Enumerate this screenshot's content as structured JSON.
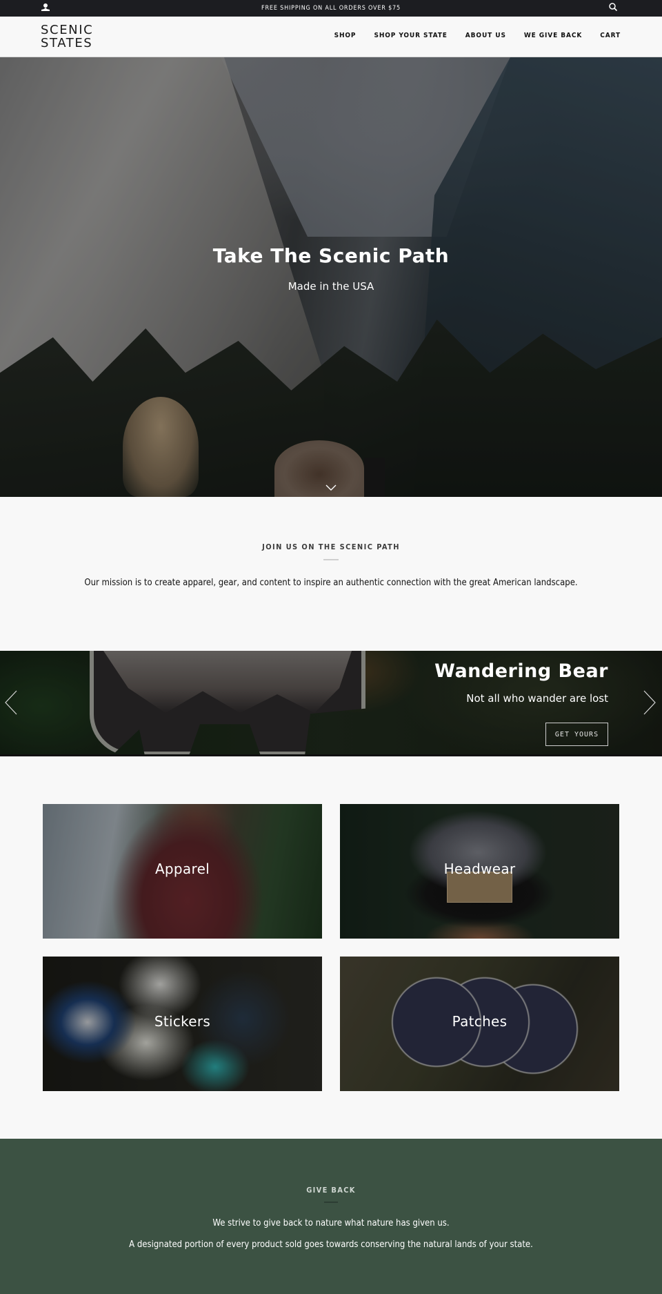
{
  "announcement": {
    "text": "FREE SHIPPING ON ALL ORDERS OVER $75",
    "left_icon": "user-icon",
    "right_icon": "search-icon"
  },
  "header": {
    "logo_line1": "SCENIC",
    "logo_line2": "STATES",
    "nav": [
      {
        "label": "SHOP"
      },
      {
        "label": "SHOP YOUR STATE"
      },
      {
        "label": "ABOUT US"
      },
      {
        "label": "WE GIVE BACK"
      },
      {
        "label": "CART"
      }
    ]
  },
  "hero": {
    "title": "Take The Scenic Path",
    "subtitle": "Made in the USA",
    "scroll_icon": "chevron-down-icon"
  },
  "mission": {
    "heading": "JOIN US ON THE SCENIC PATH",
    "text": "Our mission is to create apparel, gear, and content to inspire an authentic connection with the great American landscape."
  },
  "slideshow": {
    "title": "Wandering Bear",
    "subtitle": "Not all who wander are lost",
    "button_label": "GET YOURS",
    "prev_icon": "chevron-left-icon",
    "next_icon": "chevron-right-icon"
  },
  "collections": [
    {
      "label": "Apparel"
    },
    {
      "label": "Headwear"
    },
    {
      "label": "Stickers"
    },
    {
      "label": "Patches"
    }
  ],
  "give_back": {
    "heading": "GIVE BACK",
    "line1": "We strive to give back to nature what nature has given us.",
    "line2": "A designated portion of every product sold goes towards conserving the natural lands of your state.",
    "background_color": "#3c5243"
  }
}
